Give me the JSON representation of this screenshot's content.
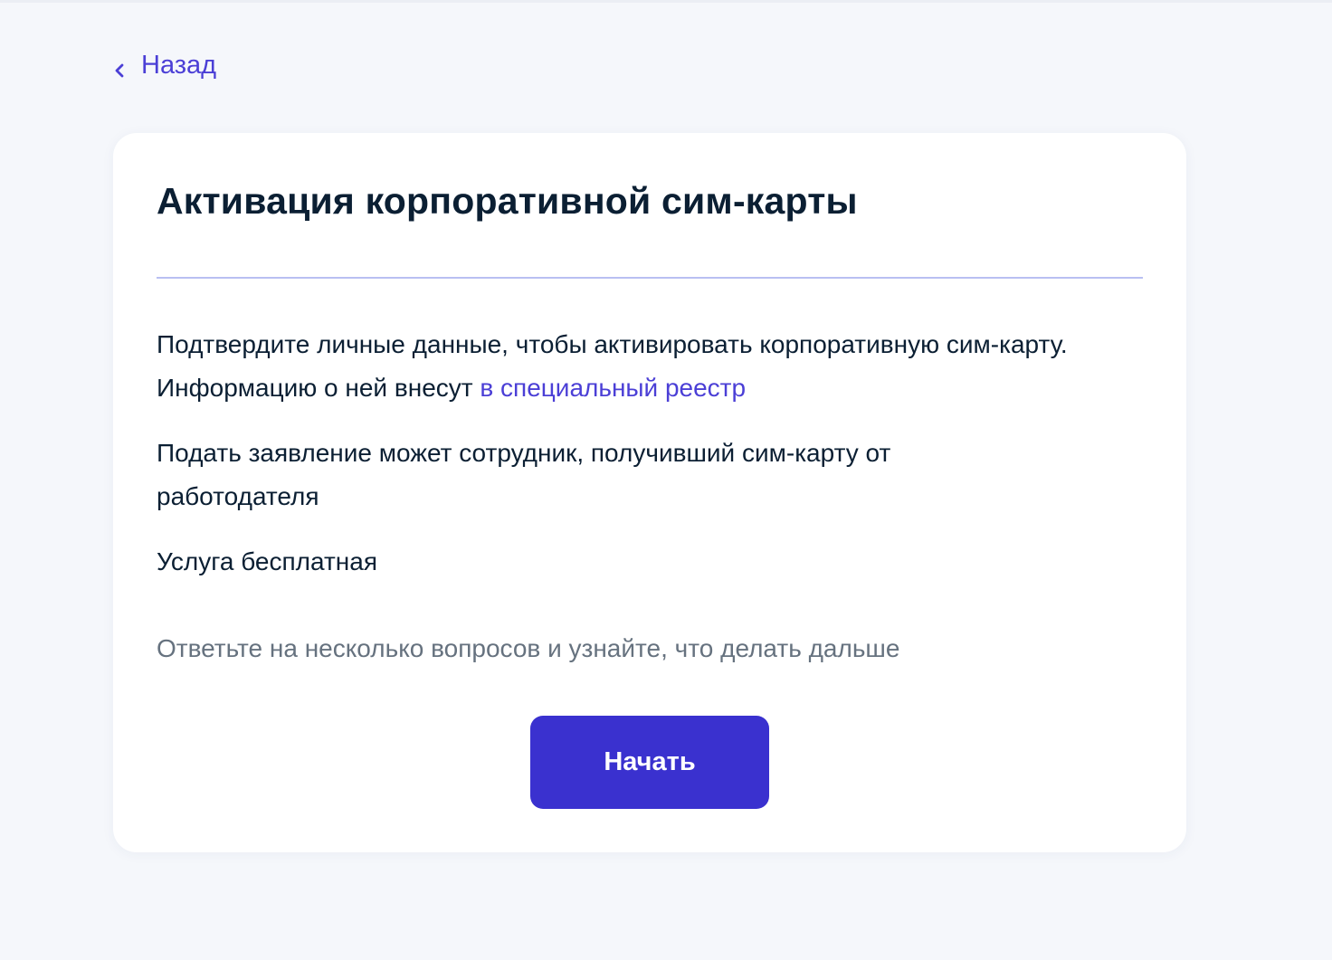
{
  "nav": {
    "back_label": "Назад",
    "back_icon": "chevron-left-icon"
  },
  "card": {
    "title": "Активация корпоративной сим-карты",
    "paragraph1_text": "Подтвердите личные данные, чтобы активировать корпоративную сим-карту. Информацию о ней внесут ",
    "paragraph1_link": "в специальный реестр",
    "paragraph2": "Подать заявление может сотрудник, получивший сим-карту от работодателя",
    "paragraph3": "Услуга бесплатная",
    "hint": "Ответьте на несколько вопросов и узнайте, что делать дальше",
    "start_button_label": "Начать"
  },
  "colors": {
    "accent": "#3a31cf",
    "link": "#4b3fd6",
    "text": "#0b1f33",
    "muted_text": "#66727f",
    "page_background": "#f5f7fb",
    "card_background": "#ffffff",
    "divider": "#b9bff2"
  }
}
